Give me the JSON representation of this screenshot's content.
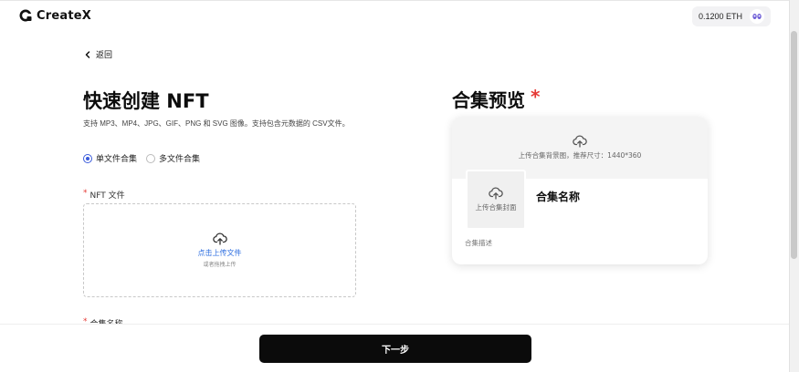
{
  "header": {
    "logo_text": "CreateX",
    "wallet_balance": "0.1200 ETH"
  },
  "nav": {
    "back_label": "返回"
  },
  "form": {
    "title": "快速创建 NFT",
    "subtitle": "支持 MP3、MP4、JPG、GIF、PNG 和 SVG 图像。支持包含元数据的 CSV文件。",
    "radio_options": [
      {
        "label": "单文件合集",
        "checked": true
      },
      {
        "label": "多文件合集",
        "checked": false
      }
    ],
    "nft_file_label": "NFT 文件",
    "upload_title": "点击上传文件",
    "upload_hint": "或者拖拽上传",
    "collection_name_label": "合集名称"
  },
  "preview": {
    "title": "合集预览",
    "required_mark": "*",
    "banner_hint": "上传合集背景图，推荐尺寸：1440*360",
    "cover_hint": "上传合集封面",
    "collection_name": "合集名称",
    "collection_desc": "合集描述"
  },
  "footer": {
    "next_label": "下一步"
  },
  "colors": {
    "accent": "#3b5bdb",
    "link": "#2f6fe0",
    "required": "#e53935",
    "button": "#0b0b0b"
  }
}
